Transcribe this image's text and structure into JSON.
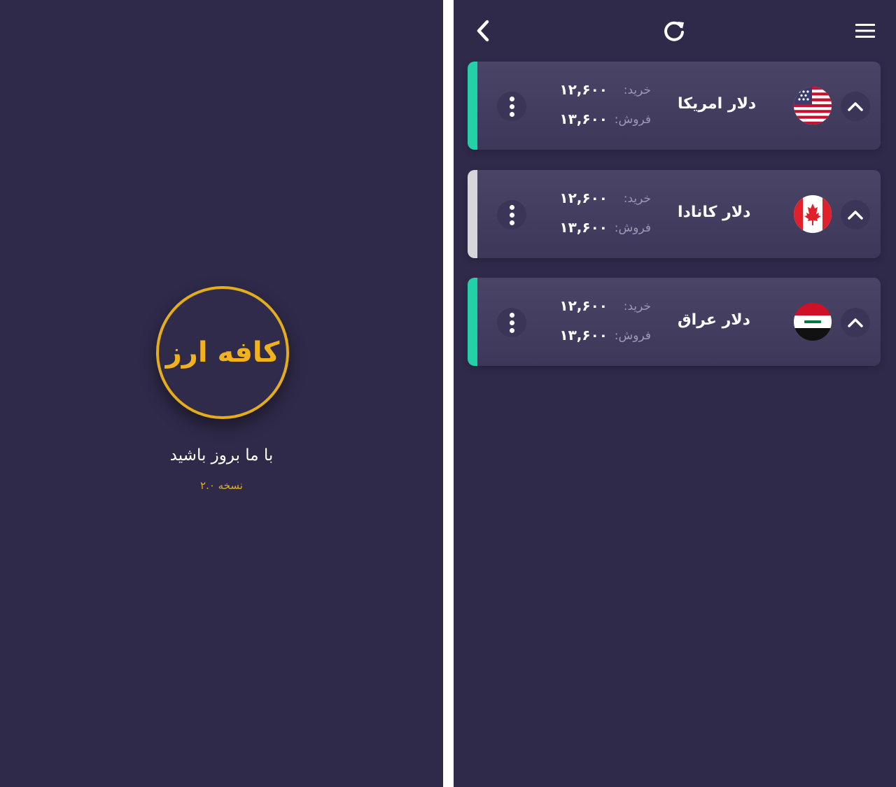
{
  "splash": {
    "logo_text": "کافه ارز",
    "tagline": "با ما بروز باشید",
    "version": "نسخه ۲.۰"
  },
  "header": {
    "back_icon": "chevron-left-icon",
    "refresh_icon": "refresh-icon",
    "menu_icon": "hamburger-menu-icon"
  },
  "currencies": [
    {
      "name": "دلار امریکا",
      "buy_label": "خرید:",
      "buy_value": "۱۲,۶۰۰",
      "sell_label": "فروش:",
      "sell_value": "۱۳,۶۰۰",
      "flag_icon": "usa-flag-icon",
      "accent_color": "#22d1a8"
    },
    {
      "name": "دلار کانادا",
      "buy_label": "خرید:",
      "buy_value": "۱۲,۶۰۰",
      "sell_label": "فروش:",
      "sell_value": "۱۳,۶۰۰",
      "flag_icon": "canada-flag-icon",
      "accent_color": "#d7d6da"
    },
    {
      "name": "دلار عراق",
      "buy_label": "خرید:",
      "buy_value": "۱۲,۶۰۰",
      "sell_label": "فروش:",
      "sell_value": "۱۳,۶۰۰",
      "flag_icon": "iraq-flag-icon",
      "accent_color": "#22d1a8"
    }
  ],
  "colors": {
    "background": "#2f2a4a",
    "card": "#453f62",
    "gold": "#e3ad1b",
    "accent_green": "#22d1a8",
    "accent_gray": "#d7d6da"
  }
}
